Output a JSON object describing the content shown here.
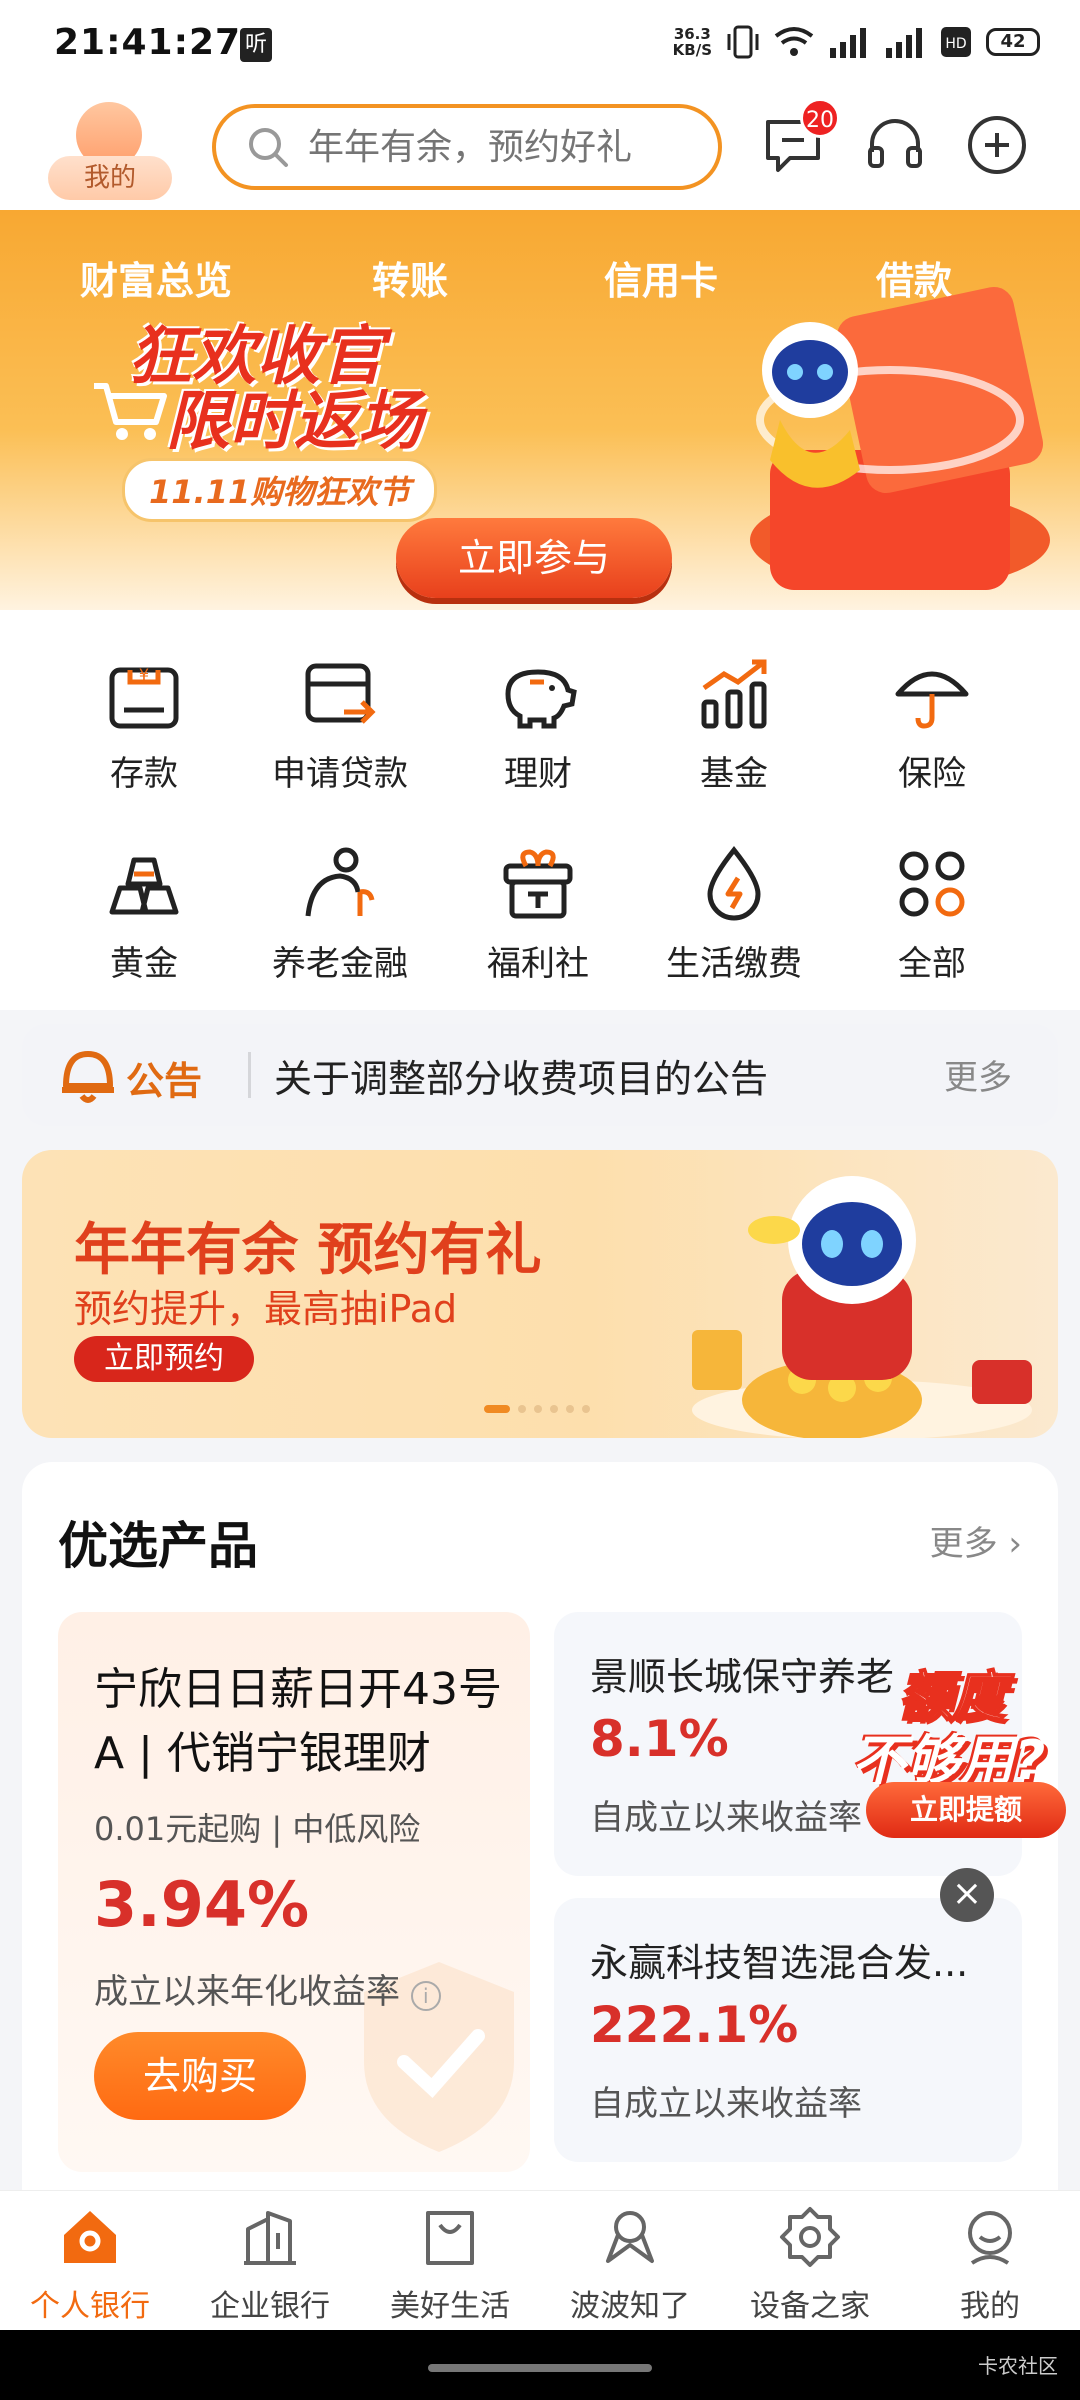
{
  "status": {
    "time": "21:41:27",
    "ting": "听",
    "net_speed_top": "36.3",
    "net_speed_bottom": "KB/S",
    "battery": "42"
  },
  "header": {
    "avatar_label": "我的",
    "search_placeholder": "年年有余，预约好礼",
    "message_badge": "20"
  },
  "banner": {
    "nav": [
      "财富总览",
      "转账",
      "信用卡",
      "借款"
    ],
    "promo_line1": "狂欢收官",
    "promo_line2": "限时返场",
    "promo_tag": "11.11购物狂欢节",
    "cta": "立即参与"
  },
  "grid": {
    "items": [
      {
        "label": "存款",
        "icon": "deposit-icon"
      },
      {
        "label": "申请贷款",
        "icon": "loan-icon"
      },
      {
        "label": "理财",
        "icon": "piggy-bank-icon"
      },
      {
        "label": "基金",
        "icon": "fund-chart-icon"
      },
      {
        "label": "保险",
        "icon": "umbrella-icon"
      },
      {
        "label": "黄金",
        "icon": "gold-icon"
      },
      {
        "label": "养老金融",
        "icon": "pension-icon"
      },
      {
        "label": "福利社",
        "icon": "gift-icon"
      },
      {
        "label": "生活缴费",
        "icon": "utility-drop-icon"
      },
      {
        "label": "全部",
        "icon": "all-apps-icon"
      }
    ]
  },
  "notice": {
    "tag": "公告",
    "text": "关于调整部分收费项目的公告",
    "more": "更多"
  },
  "ad": {
    "title": "年年有余 预约有礼",
    "subtitle": "预约提升，最高抽iPad",
    "cta": "立即预约",
    "carousel_count": 6,
    "carousel_active": 0
  },
  "products": {
    "title": "优选产品",
    "more": "更多",
    "featured": {
      "name": "宁欣日日薪日开43号A | 代销宁银理财",
      "meta": "0.01元起购 | 中低风险",
      "rate": "3.94%",
      "rate_label": "成立以来年化收益率",
      "buy": "去购买"
    },
    "cards": [
      {
        "name": "景顺长城保守养老",
        "rate": "8.1%",
        "rate_label": "自成立以来收益率"
      },
      {
        "name": "永赢科技智选混合发...",
        "rate": "222.1%",
        "rate_label": "自成立以来收益率"
      }
    ]
  },
  "float_ad": {
    "line1": "额度",
    "line2": "不够用?",
    "cta": "立即提额"
  },
  "tabbar": {
    "tabs": [
      {
        "label": "个人银行",
        "active": true
      },
      {
        "label": "企业银行",
        "active": false
      },
      {
        "label": "美好生活",
        "active": false
      },
      {
        "label": "波波知了",
        "active": false
      },
      {
        "label": "设备之家",
        "active": false
      },
      {
        "label": "我的",
        "active": false
      }
    ]
  },
  "watermark": "卡农社区",
  "colors": {
    "accent": "#f26a10",
    "rate_red": "#d8302a",
    "banner_orange": "#f8a832"
  }
}
